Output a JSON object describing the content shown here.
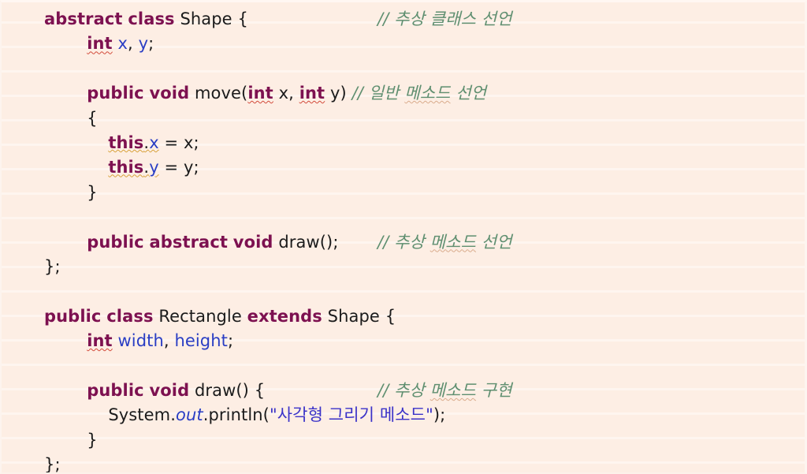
{
  "panel": {
    "name": "java-code-snippet",
    "background_color": "#fdeee4",
    "stripe_color": "#fff6ef",
    "language": "Java"
  },
  "theme": {
    "keyword_color": "#7d1150",
    "identifier_color": "#2a3ec4",
    "comment_color": "#5f8f70",
    "string_color": "#3a32c8",
    "text_color": "#1b1b1b",
    "spellcheck_squiggle_color": "#d24a3a"
  },
  "code": {
    "lines": [
      {
        "index": 1,
        "indent": 0,
        "tokens": [
          {
            "t": "abstract",
            "k": "kw"
          },
          {
            "t": " ",
            "k": "plain"
          },
          {
            "t": "class",
            "k": "kw"
          },
          {
            "t": " Shape {",
            "k": "plain"
          }
        ],
        "comment": "// 추상 클래스 선언",
        "comment_col": 477
      },
      {
        "index": 2,
        "indent": 1,
        "tokens": [
          {
            "t": "int",
            "k": "kw-sq"
          },
          {
            "t": " ",
            "k": "plain"
          },
          {
            "t": "x",
            "k": "var"
          },
          {
            "t": ", ",
            "k": "plain"
          },
          {
            "t": "y",
            "k": "var"
          },
          {
            "t": ";",
            "k": "plain"
          }
        ],
        "comment": "",
        "comment_col": 0
      },
      {
        "index": 3,
        "indent": 0,
        "tokens": [],
        "comment": "",
        "comment_col": 0
      },
      {
        "index": 4,
        "indent": 1,
        "tokens": [
          {
            "t": "public",
            "k": "kw"
          },
          {
            "t": " ",
            "k": "plain"
          },
          {
            "t": "void",
            "k": "kw"
          },
          {
            "t": " move(",
            "k": "plain"
          },
          {
            "t": "int",
            "k": "kw-sq"
          },
          {
            "t": " x, ",
            "k": "plain"
          },
          {
            "t": "int",
            "k": "kw-sq"
          },
          {
            "t": " y)",
            "k": "plain"
          }
        ],
        "comment": "// 일반 메소드 선언",
        "comment_col": 0,
        "comment_inline": true
      },
      {
        "index": 5,
        "indent": 1,
        "tokens": [
          {
            "t": "{",
            "k": "plain"
          }
        ],
        "comment": "",
        "comment_col": 0
      },
      {
        "index": 6,
        "indent": 2,
        "tokens": [
          {
            "t": "this",
            "k": "thisref"
          },
          {
            "t": ".",
            "k": "plain"
          },
          {
            "t": "x",
            "k": "var"
          },
          {
            "t": " = x;",
            "k": "plain"
          }
        ],
        "comment": "",
        "comment_col": 0,
        "squiggle_prefix": 3
      },
      {
        "index": 7,
        "indent": 2,
        "tokens": [
          {
            "t": "this",
            "k": "thisref"
          },
          {
            "t": ".",
            "k": "plain"
          },
          {
            "t": "y",
            "k": "var"
          },
          {
            "t": " = y;",
            "k": "plain"
          }
        ],
        "comment": "",
        "comment_col": 0,
        "squiggle_prefix": 3
      },
      {
        "index": 8,
        "indent": 1,
        "tokens": [
          {
            "t": "}",
            "k": "plain"
          }
        ],
        "comment": "",
        "comment_col": 0
      },
      {
        "index": 9,
        "indent": 0,
        "tokens": [],
        "comment": "",
        "comment_col": 0
      },
      {
        "index": 10,
        "indent": 1,
        "tokens": [
          {
            "t": "public",
            "k": "kw"
          },
          {
            "t": " ",
            "k": "plain"
          },
          {
            "t": "abstract",
            "k": "kw"
          },
          {
            "t": " ",
            "k": "plain"
          },
          {
            "t": "void",
            "k": "kw"
          },
          {
            "t": " draw();",
            "k": "plain"
          }
        ],
        "comment": "// 추상 메소드 선언",
        "comment_col": 477
      },
      {
        "index": 11,
        "indent": 0,
        "tokens": [
          {
            "t": "};",
            "k": "plain"
          }
        ],
        "comment": "",
        "comment_col": 0
      },
      {
        "index": 12,
        "indent": 0,
        "tokens": [],
        "comment": "",
        "comment_col": 0
      },
      {
        "index": 13,
        "indent": 0,
        "tokens": [
          {
            "t": "public",
            "k": "kw"
          },
          {
            "t": " ",
            "k": "plain"
          },
          {
            "t": "class",
            "k": "kw"
          },
          {
            "t": " Rectangle ",
            "k": "plain"
          },
          {
            "t": "extends",
            "k": "kw"
          },
          {
            "t": " Shape {",
            "k": "plain"
          }
        ],
        "comment": "",
        "comment_col": 0
      },
      {
        "index": 14,
        "indent": 1,
        "tokens": [
          {
            "t": "int",
            "k": "kw-sq"
          },
          {
            "t": " ",
            "k": "plain"
          },
          {
            "t": "width",
            "k": "var"
          },
          {
            "t": ", ",
            "k": "plain"
          },
          {
            "t": "height",
            "k": "var"
          },
          {
            "t": ";",
            "k": "plain"
          }
        ],
        "comment": "",
        "comment_col": 0
      },
      {
        "index": 15,
        "indent": 0,
        "tokens": [],
        "comment": "",
        "comment_col": 0
      },
      {
        "index": 16,
        "indent": 1,
        "tokens": [
          {
            "t": "public",
            "k": "kw"
          },
          {
            "t": " ",
            "k": "plain"
          },
          {
            "t": "void",
            "k": "kw"
          },
          {
            "t": " draw() {",
            "k": "plain"
          }
        ],
        "comment": "// 추상 메소드 구현",
        "comment_col": 477
      },
      {
        "index": 17,
        "indent": 2,
        "tokens": [
          {
            "t": "System",
            "k": "plain"
          },
          {
            "t": ".",
            "k": "plain"
          },
          {
            "t": "out",
            "k": "field-static"
          },
          {
            "t": ".println(",
            "k": "plain"
          },
          {
            "t": "\"사각형 그리기 메소드\"",
            "k": "str"
          },
          {
            "t": ");",
            "k": "plain"
          }
        ],
        "comment": "",
        "comment_col": 0
      },
      {
        "index": 18,
        "indent": 1,
        "tokens": [
          {
            "t": "}",
            "k": "plain"
          }
        ],
        "comment": "",
        "comment_col": 0
      },
      {
        "index": 19,
        "indent": 0,
        "tokens": [
          {
            "t": "};",
            "k": "plain"
          }
        ],
        "comment": "",
        "comment_col": 0
      }
    ]
  }
}
